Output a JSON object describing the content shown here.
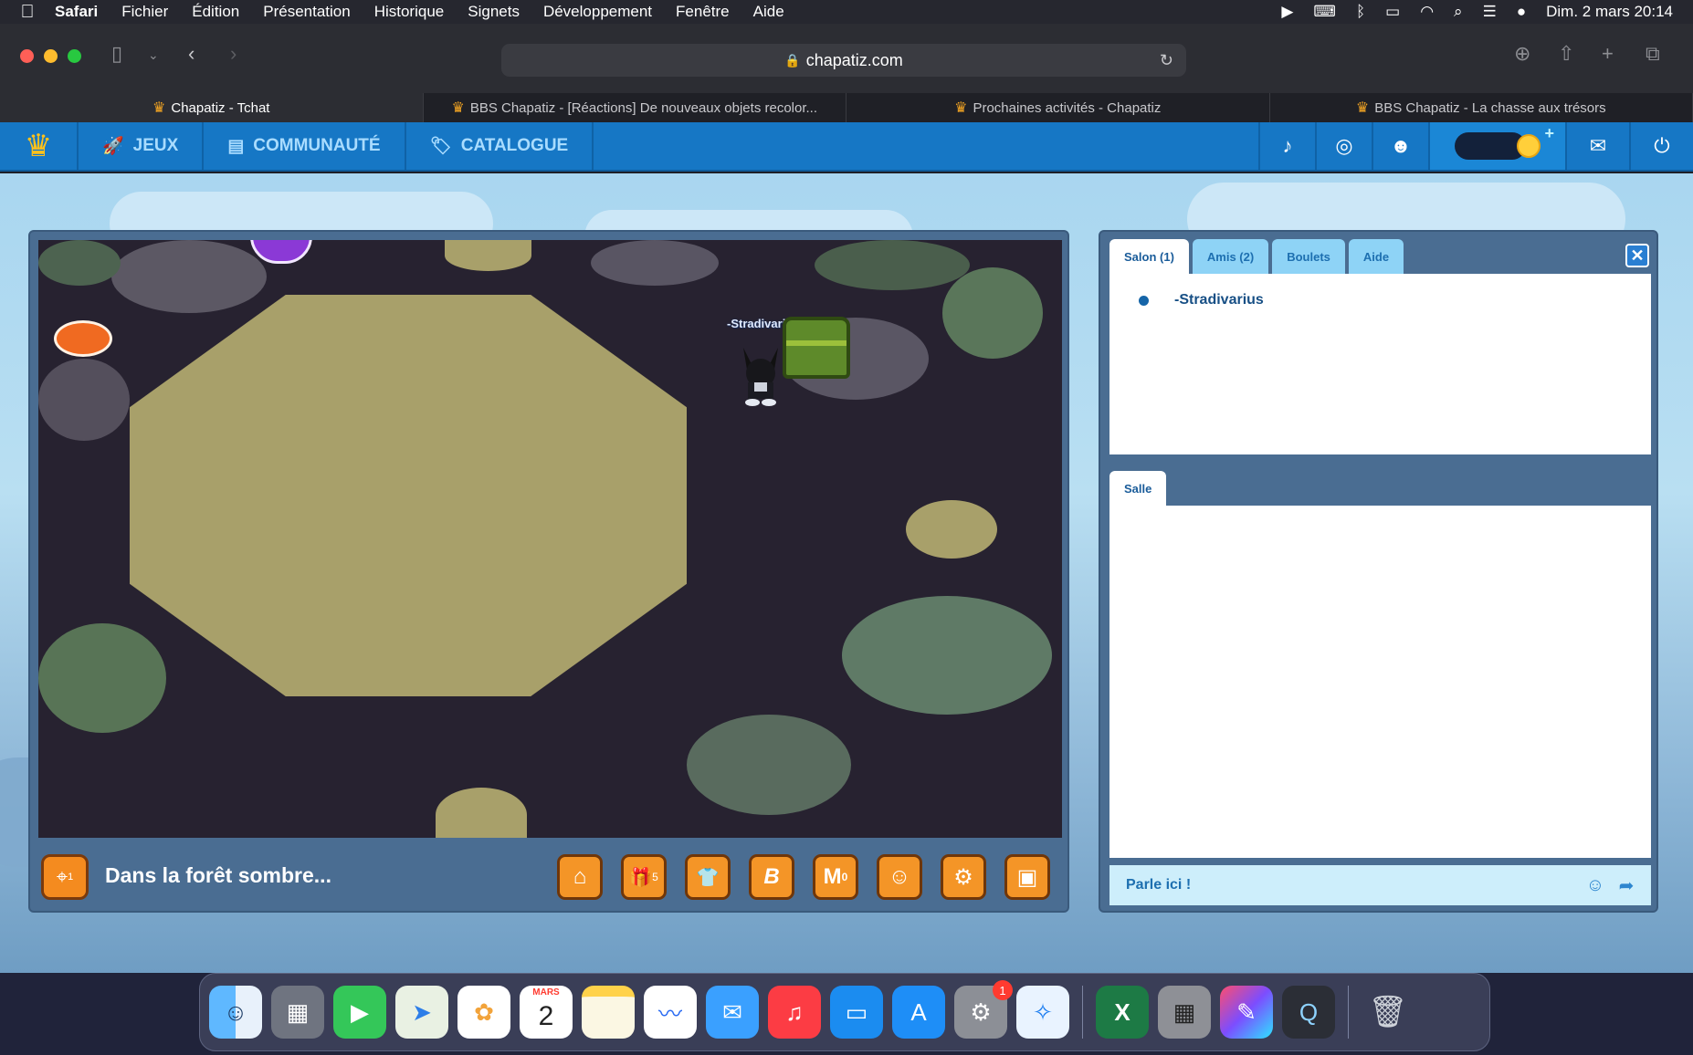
{
  "menubar": {
    "app": "Safari",
    "items": [
      "Fichier",
      "Édition",
      "Présentation",
      "Historique",
      "Signets",
      "Développement",
      "Fenêtre",
      "Aide"
    ],
    "datetime": "Dim. 2 mars  20:14"
  },
  "browser": {
    "url": "chapatiz.com",
    "tabs": [
      {
        "title": "Chapatiz - Tchat",
        "active": true
      },
      {
        "title": "BBS Chapatiz - [Réactions] De nouveaux objets recolor...",
        "active": false
      },
      {
        "title": "Prochaines activités - Chapatiz",
        "active": false
      },
      {
        "title": "BBS Chapatiz - La chasse aux trésors",
        "active": false
      }
    ]
  },
  "site_nav": {
    "items": [
      {
        "label": "JEUX",
        "icon": "rocket-icon"
      },
      {
        "label": "COMMUNAUTÉ",
        "icon": "board-icon"
      },
      {
        "label": "CATALOGUE",
        "icon": "tag-icon"
      }
    ],
    "social": [
      "tiktok-icon",
      "instagram-icon",
      "discord-icon"
    ],
    "right_icons": [
      "mail-icon",
      "power-icon"
    ]
  },
  "game": {
    "player_name": "-Stradivarius",
    "room_title": "Dans la forêt sombre...",
    "room_icon_count": "1",
    "buttons": [
      {
        "name": "home",
        "glyph": "⌂",
        "count": ""
      },
      {
        "name": "gifts",
        "glyph": "🎁",
        "count": "5"
      },
      {
        "name": "wardrobe",
        "glyph": "👕",
        "count": ""
      },
      {
        "name": "bazar",
        "glyph": "B",
        "count": ""
      },
      {
        "name": "mail",
        "glyph": "M",
        "count": "0"
      },
      {
        "name": "friends",
        "glyph": "☺",
        "count": ""
      },
      {
        "name": "settings",
        "glyph": "⚙",
        "count": ""
      },
      {
        "name": "radio",
        "glyph": "▣",
        "count": ""
      }
    ]
  },
  "chat": {
    "tabs": [
      "Salon (1)",
      "Amis (2)",
      "Boulets",
      "Aide"
    ],
    "salon_users": [
      "-Stradivarius"
    ],
    "salle_tab": "Salle",
    "input_placeholder": "Parle ici !"
  },
  "dock": {
    "calendar_month": "MARS",
    "calendar_day": "2",
    "settings_badge": "1"
  },
  "colors": {
    "nav_blue": "#1677c5",
    "game_orange": "#f49527",
    "chat_panel": "#4a6d92"
  }
}
